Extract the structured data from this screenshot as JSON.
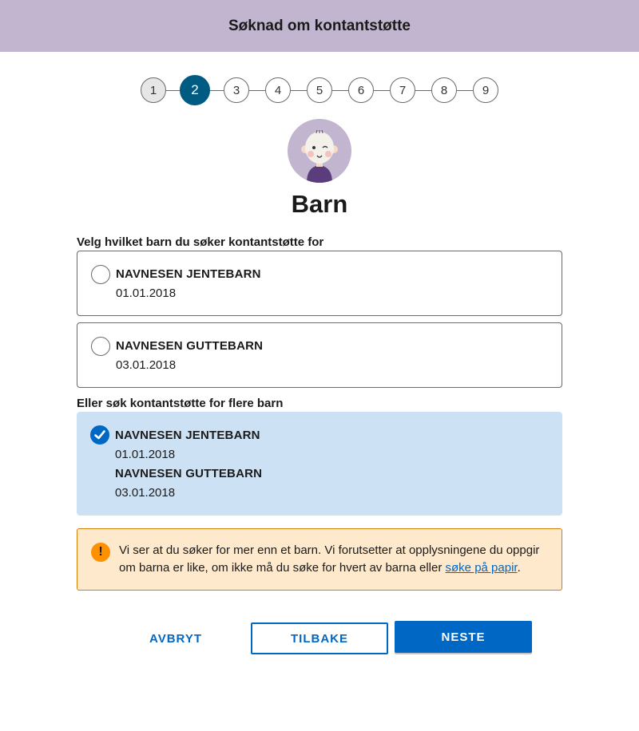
{
  "header": {
    "title": "Søknad om kontantstøtte"
  },
  "stepper": {
    "steps": [
      {
        "label": "1",
        "state": "done"
      },
      {
        "label": "2",
        "state": "active"
      },
      {
        "label": "3",
        "state": "todo"
      },
      {
        "label": "4",
        "state": "todo"
      },
      {
        "label": "5",
        "state": "todo"
      },
      {
        "label": "6",
        "state": "todo"
      },
      {
        "label": "7",
        "state": "todo"
      },
      {
        "label": "8",
        "state": "todo"
      },
      {
        "label": "9",
        "state": "todo"
      }
    ]
  },
  "page": {
    "title": "Barn",
    "avatar_icon": "baby-avatar-icon"
  },
  "single_child": {
    "label": "Velg hvilket barn du søker kontantstøtte for",
    "options": [
      {
        "name": "NAVNESEN JENTEBARN",
        "birthdate": "01.01.2018",
        "checked": false
      },
      {
        "name": "NAVNESEN GUTTEBARN",
        "birthdate": "03.01.2018",
        "checked": false
      }
    ]
  },
  "multi_child": {
    "label": "Eller søk kontantstøtte for flere barn",
    "checked": true,
    "children": [
      {
        "name": "NAVNESEN JENTEBARN",
        "birthdate": "01.01.2018"
      },
      {
        "name": "NAVNESEN GUTTEBARN",
        "birthdate": "03.01.2018"
      }
    ]
  },
  "alert": {
    "icon": "exclamation-icon",
    "text_before": "Vi ser at du søker for mer enn et barn. Vi forutsetter at opplysningene du oppgir om barna er like, om ikke må du søke for hvert av barna eller ",
    "link": "søke på papir",
    "text_after": "."
  },
  "buttons": {
    "cancel": "AVBRYT",
    "back": "TILBAKE",
    "next": "NESTE"
  },
  "colors": {
    "header_bg": "#c1b5d0",
    "active_step": "#005b82",
    "primary": "#0067c5",
    "selected_bg": "#cce1f3",
    "alert_bg": "#ffe9cc",
    "alert_icon": "#ff9100"
  }
}
